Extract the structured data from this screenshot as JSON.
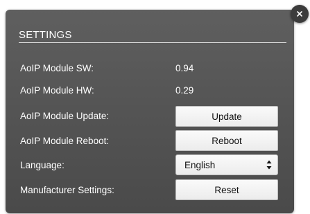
{
  "dialog": {
    "title": "SETTINGS",
    "rows": [
      {
        "label": "AoIP Module SW:",
        "value": "0.94"
      },
      {
        "label": "AoIP Module HW:",
        "value": "0.29"
      },
      {
        "label": "AoIP Module Update:",
        "button": "Update"
      },
      {
        "label": "AoIP Module Reboot:",
        "button": "Reboot"
      },
      {
        "label": "Language:",
        "select": "English"
      },
      {
        "label": "Manufacturer Settings:",
        "button": "Reset"
      }
    ]
  },
  "colors": {
    "panel": "#555555",
    "text": "#ffffff",
    "button_bg": "#f2f2f2",
    "close_bg": "#3c3c3c"
  },
  "icons": {
    "close": "close-icon",
    "select_arrows": "chevron-updown-icon"
  }
}
